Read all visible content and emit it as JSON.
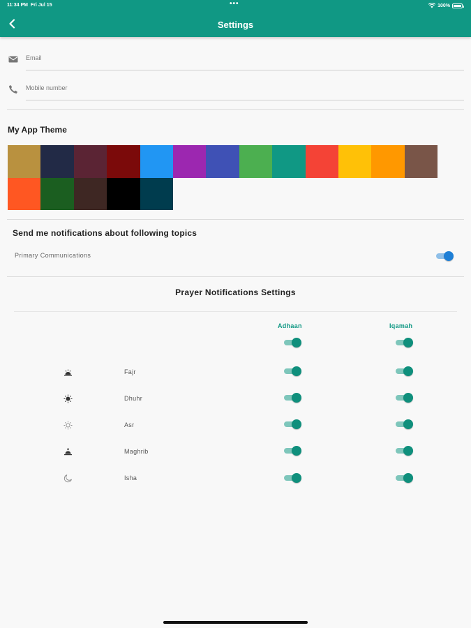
{
  "status_bar": {
    "time": "11:34 PM",
    "date": "Fri Jul 15",
    "battery": "100%"
  },
  "header": {
    "title": "Settings"
  },
  "profile": {
    "email_label": "Email",
    "mobile_label": "Mobile number"
  },
  "theme": {
    "title": "My App Theme",
    "colors": [
      "#b9913f",
      "#222a46",
      "#5b2434",
      "#7b0a0a",
      "#2196f3",
      "#9c27b0",
      "#3f51b5",
      "#4caf50",
      "#109884",
      "#f44336",
      "#ffc107",
      "#ff9800",
      "#795548",
      "#ff5722",
      "#1b5e20",
      "#3e2723",
      "#000000",
      "#003c4e"
    ]
  },
  "notifications": {
    "title": "Send me notifications about following topics",
    "items": [
      {
        "label": "Primary Communications",
        "enabled": true
      }
    ]
  },
  "prayer": {
    "title": "Prayer Notifications Settings",
    "col_adhaan": "Adhaan",
    "col_iqamah": "Iqamah",
    "all": {
      "adhaan": true,
      "iqamah": true
    },
    "rows": [
      {
        "name": "Fajr",
        "icon": "sunrise-icon",
        "adhaan": true,
        "iqamah": true
      },
      {
        "name": "Dhuhr",
        "icon": "sun-icon",
        "adhaan": true,
        "iqamah": true
      },
      {
        "name": "Asr",
        "icon": "sun-outline-icon",
        "adhaan": true,
        "iqamah": true
      },
      {
        "name": "Maghrib",
        "icon": "sunset-icon",
        "adhaan": true,
        "iqamah": true
      },
      {
        "name": "Isha",
        "icon": "moon-icon",
        "adhaan": true,
        "iqamah": true
      }
    ]
  },
  "colors": {
    "primary": "#109884",
    "accent_blue": "#1e7fd6"
  }
}
